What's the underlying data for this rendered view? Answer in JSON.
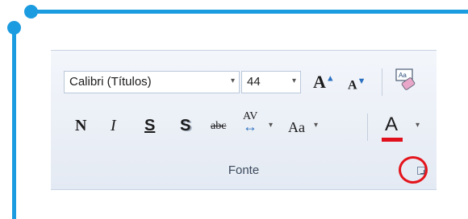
{
  "ribbon": {
    "font_name": "Calibri (Títulos)",
    "font_size": "44",
    "dropdown_glyph": "▾",
    "grow_label": "A",
    "shrink_label": "A",
    "bold_label": "N",
    "italic_label": "I",
    "underline_label": "S",
    "shadow_label": "S",
    "strike_label": "abc",
    "spacing_label": "AV",
    "spacing_arrow": "↔",
    "case_label": "Aa",
    "color_label": "A",
    "group_label": "Fonte"
  },
  "colors": {
    "frame": "#1c9ce0",
    "font_color_bar": "#e0101d",
    "highlight_ring": "#e4141c"
  },
  "icons": {
    "clear_formatting": "eraser-icon",
    "dialog_launcher": "dialog-launcher-icon"
  }
}
